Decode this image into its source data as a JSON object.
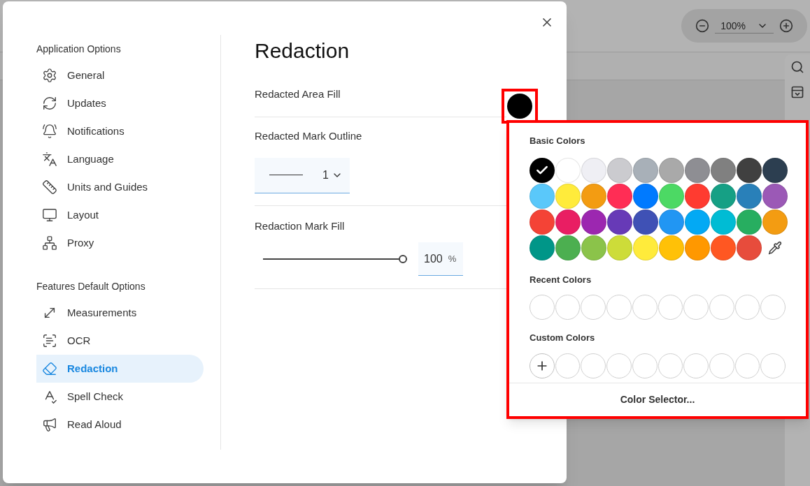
{
  "background_app": {
    "zoom": {
      "value": "100%"
    }
  },
  "dialog": {
    "sidebar": {
      "sections": [
        {
          "heading": "Application Options",
          "items": [
            {
              "label": "General",
              "selected": false
            },
            {
              "label": "Updates",
              "selected": false
            },
            {
              "label": "Notifications",
              "selected": false
            },
            {
              "label": "Language",
              "selected": false
            },
            {
              "label": "Units and Guides",
              "selected": false
            },
            {
              "label": "Layout",
              "selected": false
            },
            {
              "label": "Proxy",
              "selected": false
            }
          ]
        },
        {
          "heading": "Features Default Options",
          "items": [
            {
              "label": "Measurements",
              "selected": false
            },
            {
              "label": "OCR",
              "selected": false
            },
            {
              "label": "Redaction",
              "selected": true
            },
            {
              "label": "Spell Check",
              "selected": false
            },
            {
              "label": "Read Aloud",
              "selected": false
            }
          ]
        }
      ]
    },
    "title": "Redaction",
    "area_fill": {
      "label": "Redacted Area Fill",
      "color": "#000000"
    },
    "mark_outline": {
      "label": "Redacted Mark Outline",
      "value": "1"
    },
    "mark_fill": {
      "label": "Redaction Mark Fill",
      "level": 1,
      "value": "100",
      "unit": "%"
    }
  },
  "color_popup": {
    "basic_heading": "Basic Colors",
    "basic_colors": [
      {
        "color": "#000000",
        "selected": true
      },
      {
        "color": "#ffffff",
        "selected": false
      },
      {
        "color": "#efeff4",
        "selected": false
      },
      {
        "color": "#cbcbcf",
        "selected": false
      },
      {
        "color": "#a8b0b8",
        "selected": false
      },
      {
        "color": "#a9a9a9",
        "selected": false
      },
      {
        "color": "#8e8e93",
        "selected": false
      },
      {
        "color": "#808080",
        "selected": false
      },
      {
        "color": "#404040",
        "selected": false
      },
      {
        "color": "#2c3e50",
        "selected": false
      },
      {
        "color": "#5ac8fa",
        "selected": false
      },
      {
        "color": "#ffeb3b",
        "selected": false
      },
      {
        "color": "#f39c12",
        "selected": false
      },
      {
        "color": "#ff2d55",
        "selected": false
      },
      {
        "color": "#007aff",
        "selected": false
      },
      {
        "color": "#4cd964",
        "selected": false
      },
      {
        "color": "#ff3b30",
        "selected": false
      },
      {
        "color": "#16a085",
        "selected": false
      },
      {
        "color": "#2980b9",
        "selected": false
      },
      {
        "color": "#9b59b6",
        "selected": false
      },
      {
        "color": "#f44336",
        "selected": false
      },
      {
        "color": "#e91e63",
        "selected": false
      },
      {
        "color": "#9c27b0",
        "selected": false
      },
      {
        "color": "#673ab7",
        "selected": false
      },
      {
        "color": "#3f51b5",
        "selected": false
      },
      {
        "color": "#2196f3",
        "selected": false
      },
      {
        "color": "#03a9f4",
        "selected": false
      },
      {
        "color": "#00bcd4",
        "selected": false
      },
      {
        "color": "#27ae60",
        "selected": false
      },
      {
        "color": "#f39c12",
        "selected": false
      },
      {
        "color": "#009688",
        "selected": false
      },
      {
        "color": "#4caf50",
        "selected": false
      },
      {
        "color": "#8bc34a",
        "selected": false
      },
      {
        "color": "#cddc39",
        "selected": false
      },
      {
        "color": "#ffeb3b",
        "selected": false
      },
      {
        "color": "#ffc107",
        "selected": false
      },
      {
        "color": "#ff9800",
        "selected": false
      },
      {
        "color": "#ff5722",
        "selected": false
      },
      {
        "color": "#e74c3c",
        "selected": false
      }
    ],
    "recent_heading": "Recent Colors",
    "custom_heading": "Custom Colors",
    "footer_button": "Color Selector..."
  }
}
